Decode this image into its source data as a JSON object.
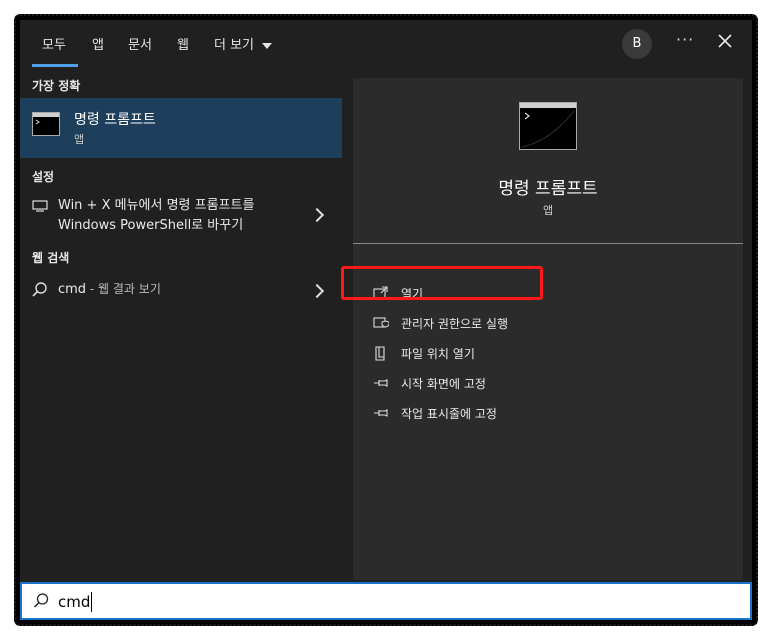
{
  "tabs": [
    {
      "label": "모두"
    },
    {
      "label": "앱"
    },
    {
      "label": "문서"
    },
    {
      "label": "웹"
    },
    {
      "label": "더 보기"
    }
  ],
  "user": {
    "initial": "B"
  },
  "more_label": "···",
  "left": {
    "best_match": {
      "heading": "가장 정확",
      "title": "명령 프롬프트",
      "subtitle": "앱"
    },
    "settings": {
      "heading": "설정",
      "line1": "Win + X 메뉴에서 명령 프롬프트를",
      "line2": "Windows PowerShell로 바꾸기"
    },
    "web_search": {
      "heading": "웹 검색",
      "query": "cmd",
      "suffix": " - 웹 결과 보기"
    }
  },
  "right": {
    "title": "명령 프롬프트",
    "subtitle": "앱",
    "actions": [
      {
        "label": "열기",
        "icon": "open-icon"
      },
      {
        "label": "관리자 권한으로 실행",
        "icon": "shield-icon"
      },
      {
        "label": "파일 위치 열기",
        "icon": "file-location-icon"
      },
      {
        "label": "시작 화면에 고정",
        "icon": "pin-icon"
      },
      {
        "label": "작업 표시줄에 고정",
        "icon": "pin-icon"
      }
    ]
  },
  "search": {
    "value": "cmd"
  },
  "colors": {
    "accent": "#4ea1e8",
    "selected": "#1e3f5c",
    "highlight": "#ff1a1a"
  }
}
